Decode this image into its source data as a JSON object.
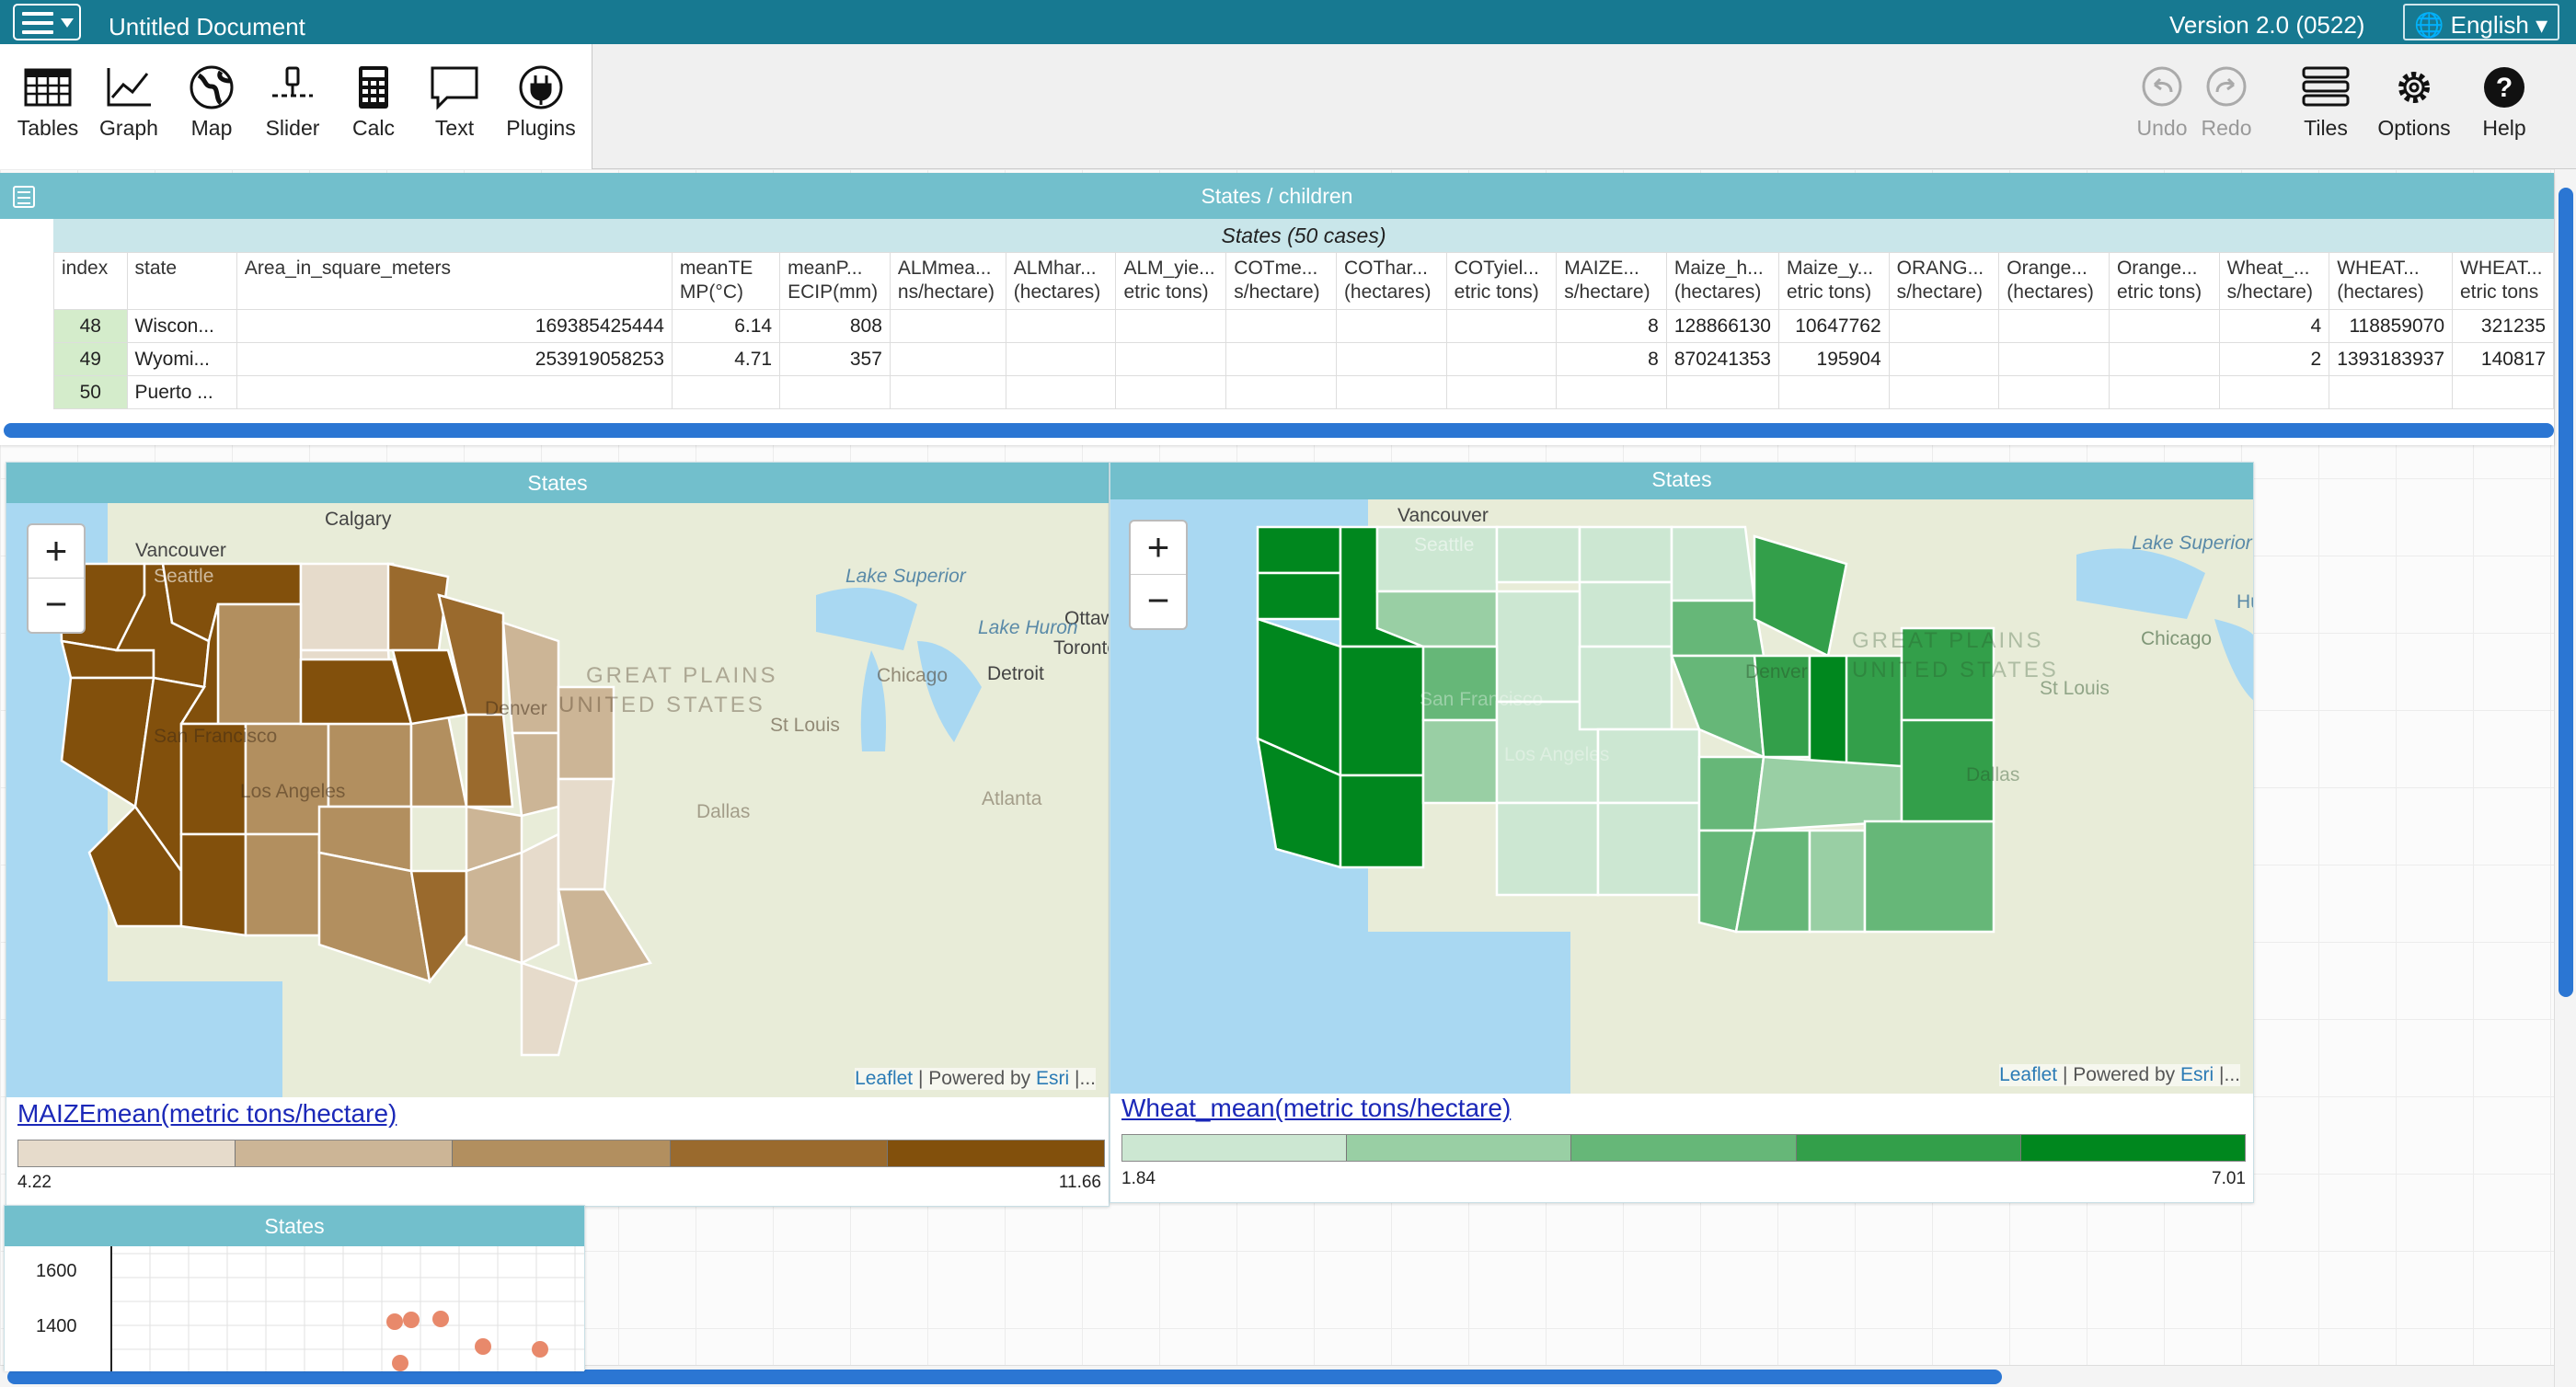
{
  "titlebar": {
    "doc_title": "Untitled Document",
    "version": "Version 2.0 (0522)",
    "language": "English"
  },
  "toolbar": {
    "left": [
      "Tables",
      "Graph",
      "Map",
      "Slider",
      "Calc",
      "Text",
      "Plugins"
    ],
    "undo": "Undo",
    "redo": "Redo",
    "tiles": "Tiles",
    "options": "Options",
    "help": "Help"
  },
  "table": {
    "title": "States / children",
    "collection": "States (50 cases)",
    "headers": [
      [
        "index",
        ""
      ],
      [
        "state",
        ""
      ],
      [
        "Area_in_square_meters",
        ""
      ],
      [
        "meanTE",
        "MP(°C)"
      ],
      [
        "meanP...",
        "ECIP(mm)"
      ],
      [
        "ALMmea...",
        "ns/hectare)"
      ],
      [
        "ALMhar...",
        "(hectares)"
      ],
      [
        "ALM_yie...",
        "etric tons)"
      ],
      [
        "COTme...",
        "s/hectare)"
      ],
      [
        "COThar...",
        "(hectares)"
      ],
      [
        "COTyiel...",
        "etric tons)"
      ],
      [
        "MAIZE...",
        "s/hectare)"
      ],
      [
        "Maize_h...",
        "(hectares)"
      ],
      [
        "Maize_y...",
        "etric tons)"
      ],
      [
        "ORANG...",
        "s/hectare)"
      ],
      [
        "Orange...",
        "(hectares)"
      ],
      [
        "Orange...",
        "etric tons)"
      ],
      [
        "Wheat_...",
        "s/hectare)"
      ],
      [
        "WHEAT...",
        "(hectares)"
      ],
      [
        "WHEAT...",
        "etric tons"
      ]
    ],
    "rows": [
      [
        "48",
        "Wiscon...",
        "169385425444",
        "6.14",
        "808",
        "",
        "",
        "",
        "",
        "",
        "",
        "8",
        "128866130",
        "10647762",
        "",
        "",
        "",
        "4",
        "118859070",
        "321235"
      ],
      [
        "49",
        "Wyomi...",
        "253919058253",
        "4.71",
        "357",
        "",
        "",
        "",
        "",
        "",
        "",
        "8",
        "870241353",
        "195904",
        "",
        "",
        "",
        "2",
        "1393183937",
        "140817"
      ],
      [
        "50",
        "Puerto ...",
        "",
        "",
        "",
        "",
        "",
        "",
        "",
        "",
        "",
        "",
        "",
        "",
        "",
        "",
        "",
        "",
        "",
        ""
      ]
    ]
  },
  "map1": {
    "title": "States",
    "legend_title": "MAIZEmean(metric tons/hectare)",
    "min": "4.22",
    "max": "11.66",
    "colors": [
      "#e6dbcb",
      "#ccb596",
      "#b28f5f",
      "#9a6a2d",
      "#82500c"
    ],
    "labels": [
      "Calgary",
      "Vancouver",
      "Seattle",
      "Lake Superior",
      "Ottawa",
      "Lake Huron",
      "Toronto",
      "Detroit",
      "Chicago",
      "GREAT PLAINS",
      "UNITED STATES",
      "Denver",
      "San Francisco",
      "Los Angeles",
      "St Louis",
      "Atlanta",
      "Dallas"
    ],
    "attribution": "Leaflet",
    "powered": "| Powered by",
    "esri": "Esri",
    "trail": "|..."
  },
  "map2": {
    "title": "States",
    "legend_title": "Wheat_mean(metric tons/hectare)",
    "min": "1.84",
    "max": "7.01",
    "colors": [
      "#cce7d2",
      "#99cfa4",
      "#66b778",
      "#339f4a",
      "#00871e"
    ],
    "labels": [
      "Vancouver",
      "Seattle",
      "Lake Superior",
      "GREAT PLAINS",
      "UNITED STATES",
      "Denver",
      "San Francisco",
      "Los Angeles",
      "St Louis",
      "Chicago",
      "Dallas",
      "Hu"
    ],
    "attribution": "Leaflet",
    "powered": "| Powered by",
    "esri": "Esri",
    "trail": "|..."
  },
  "graph": {
    "title": "States",
    "y_ticks": [
      "1600",
      "1400"
    ],
    "point_color": "#e8896b"
  }
}
